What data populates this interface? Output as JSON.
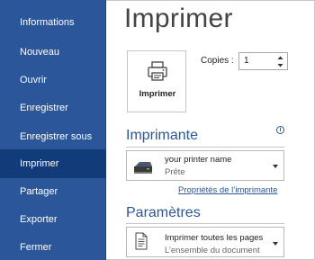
{
  "sidebar": {
    "items": [
      {
        "label": "Informations",
        "selected": false
      },
      {
        "label": "Nouveau",
        "selected": false
      },
      {
        "label": "Ouvrir",
        "selected": false
      },
      {
        "label": "Enregistrer",
        "selected": false
      },
      {
        "label": "Enregistrer sous",
        "selected": false
      },
      {
        "label": "Imprimer",
        "selected": true
      },
      {
        "label": "Partager",
        "selected": false
      },
      {
        "label": "Exporter",
        "selected": false
      },
      {
        "label": "Fermer",
        "selected": false
      }
    ]
  },
  "main": {
    "title": "Imprimer",
    "print_button": {
      "label": "Imprimer",
      "icon": "printer-icon"
    },
    "copies": {
      "label": "Copies :",
      "value": "1"
    },
    "printer_section": {
      "title": "Imprimante",
      "info_icon": "i",
      "selected_printer": {
        "name": "your printer name",
        "status": "Prête",
        "icon": "printer-device-icon"
      },
      "properties_link": "Propriétés de l’imprimante"
    },
    "settings_section": {
      "title": "Paramètres",
      "pages_option": {
        "title": "Imprimer toutes les pages",
        "subtitle": "L’ensemble du document",
        "icon": "document-icon"
      }
    }
  },
  "colors": {
    "sidebar_bg": "#2b579a",
    "sidebar_selected": "#123b79",
    "accent": "#2b579a"
  }
}
